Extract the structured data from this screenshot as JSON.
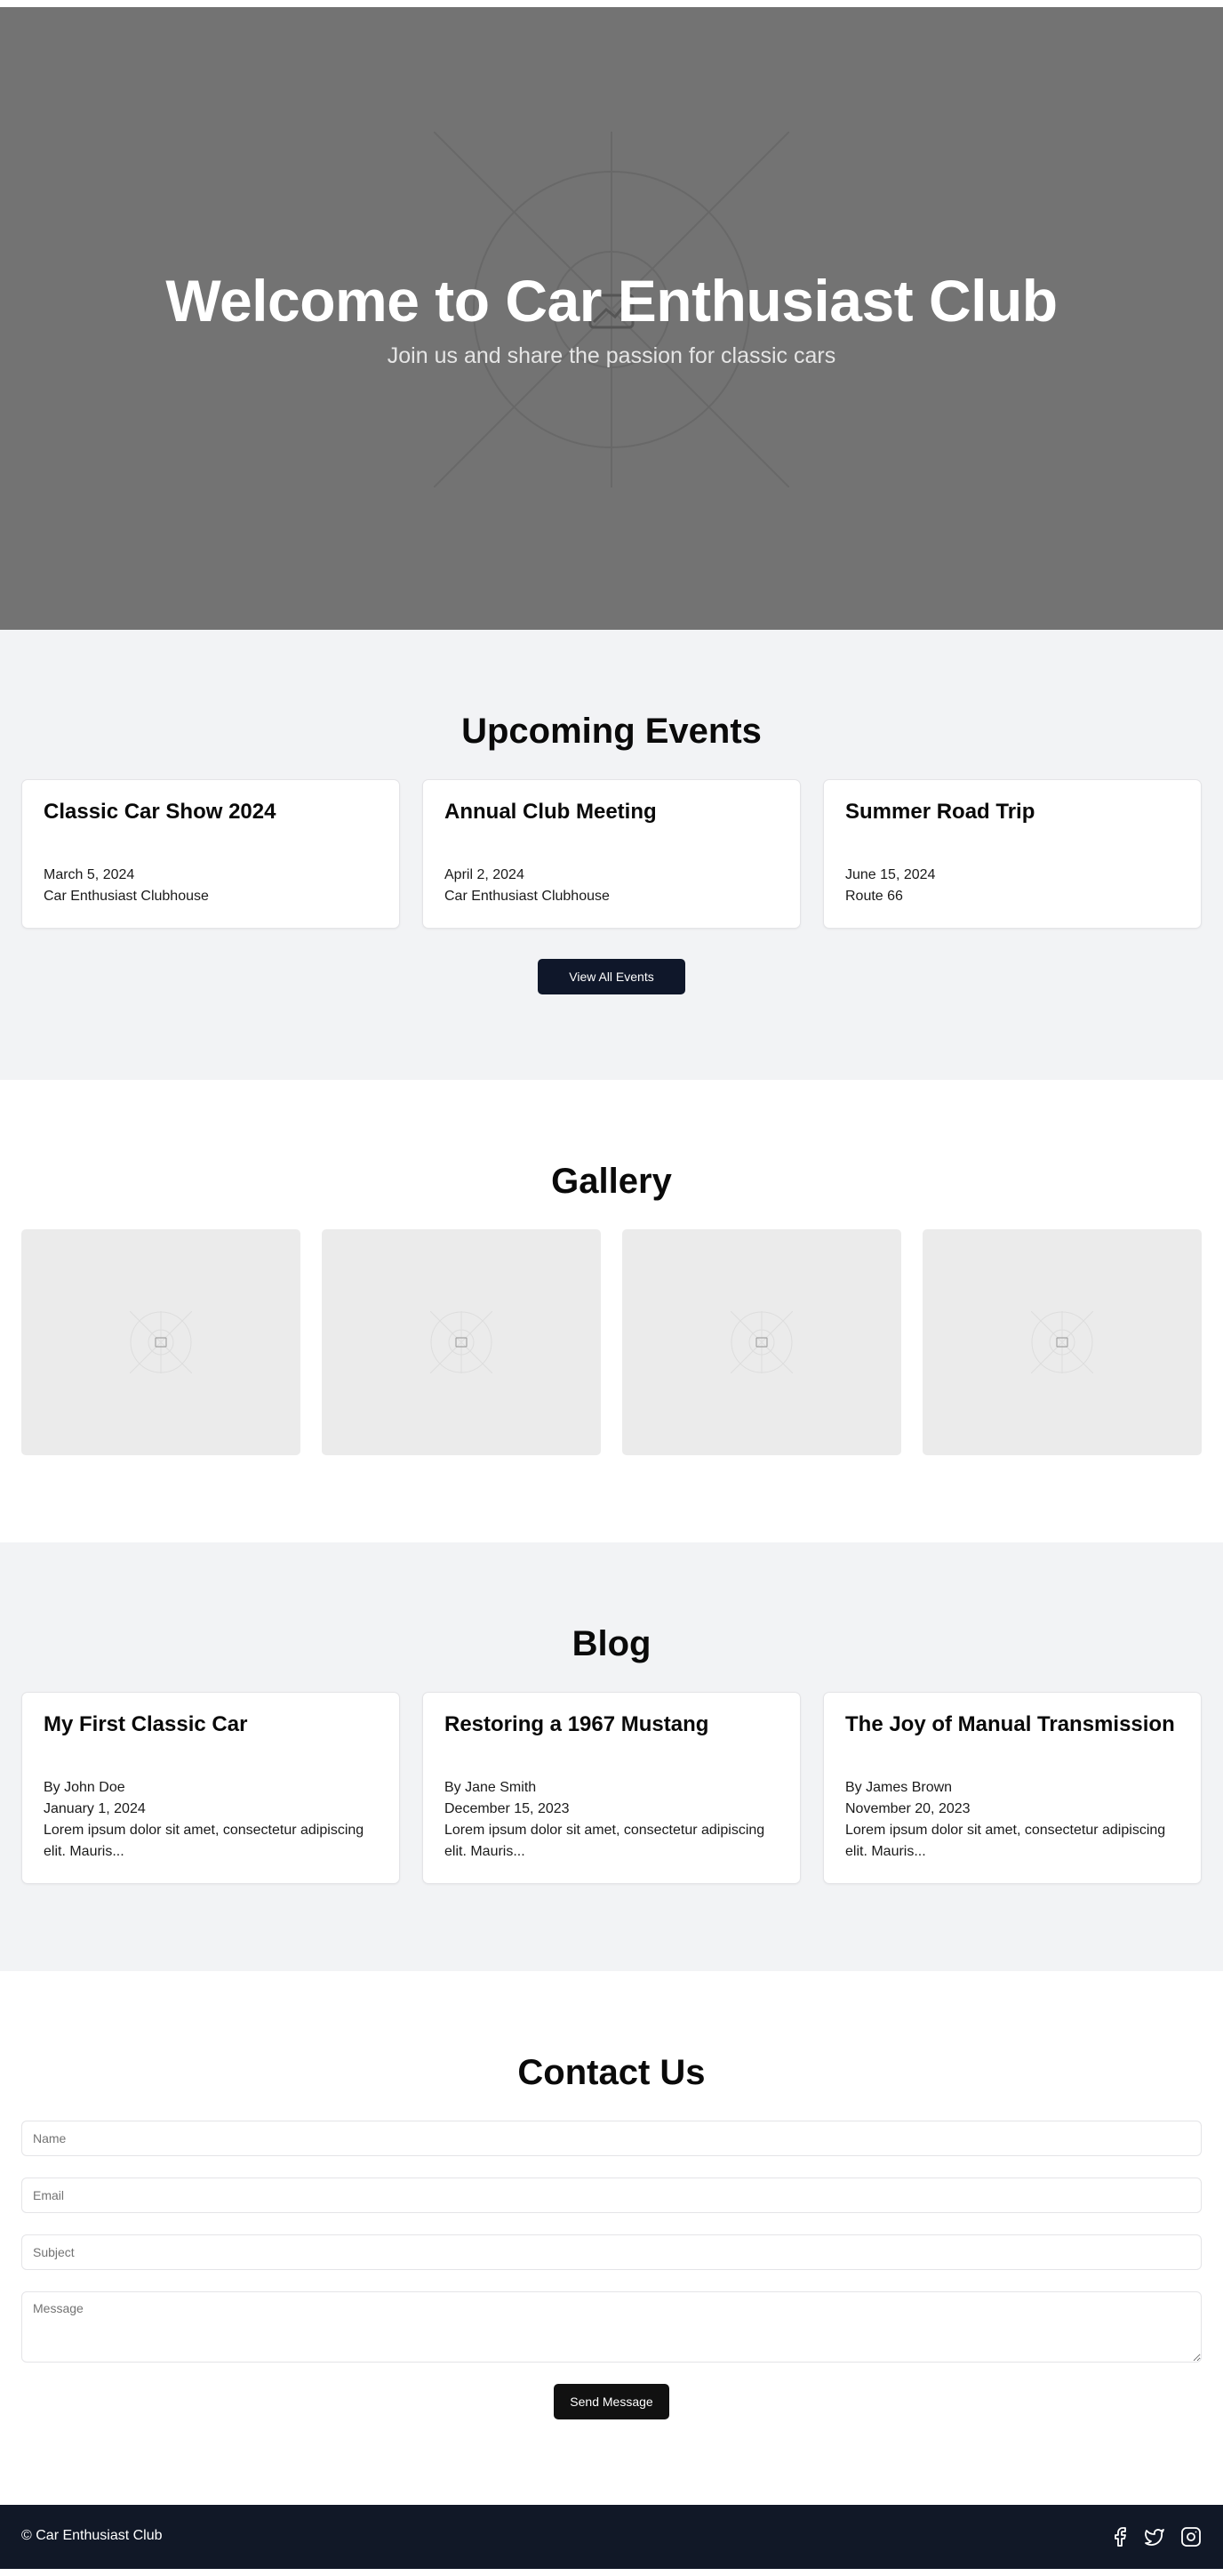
{
  "hero": {
    "title": "Welcome to Car Enthusiast Club",
    "subtitle": "Join us and share the passion for classic cars",
    "background_icon": "image-placeholder-icon"
  },
  "events": {
    "title": "Upcoming Events",
    "items": [
      {
        "title": "Classic Car Show 2024",
        "date": "March 5, 2024",
        "location": "Car Enthusiast Clubhouse"
      },
      {
        "title": "Annual Club Meeting",
        "date": "April 2, 2024",
        "location": "Car Enthusiast Clubhouse"
      },
      {
        "title": "Summer Road Trip",
        "date": "June 15, 2024",
        "location": "Route 66"
      }
    ],
    "view_all_label": "View All Events"
  },
  "gallery": {
    "title": "Gallery",
    "tile_icon": "image-placeholder-icon"
  },
  "blog": {
    "title": "Blog",
    "posts": [
      {
        "title": "My First Classic Car",
        "author": "By John Doe",
        "date": "January 1, 2024",
        "excerpt": "Lorem ipsum dolor sit amet, consectetur adipiscing elit. Mauris..."
      },
      {
        "title": "Restoring a 1967 Mustang",
        "author": "By Jane Smith",
        "date": "December 15, 2023",
        "excerpt": "Lorem ipsum dolor sit amet, consectetur adipiscing elit. Mauris..."
      },
      {
        "title": "The Joy of Manual Transmission",
        "author": "By James Brown",
        "date": "November 20, 2023",
        "excerpt": "Lorem ipsum dolor sit amet, consectetur adipiscing elit. Mauris..."
      }
    ]
  },
  "contact": {
    "title": "Contact Us",
    "name_placeholder": "Name",
    "email_placeholder": "Email",
    "subject_placeholder": "Subject",
    "message_placeholder": "Message",
    "submit_label": "Send Message"
  },
  "footer": {
    "copyright": "© Car Enthusiast Club",
    "social_icons": [
      "facebook-icon",
      "twitter-icon",
      "instagram-icon"
    ]
  },
  "colors": {
    "hero_bg": "#737373",
    "section_gray": "#f2f3f5",
    "button_dark": "#0f172a",
    "footer_bg": "#111827"
  }
}
